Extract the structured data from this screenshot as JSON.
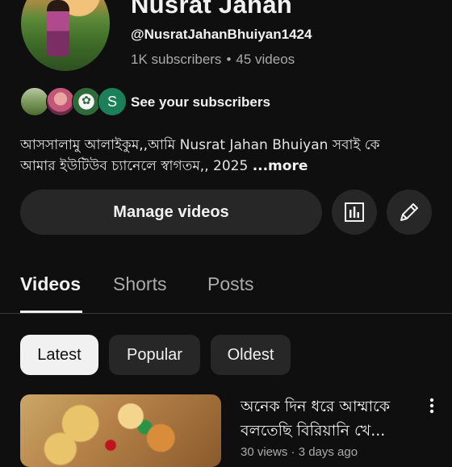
{
  "channel": {
    "name": "Nusrat Jahan",
    "handle": "@NusratJahanBhuiyan1424",
    "subscribers": "1K subscribers",
    "separator": "•",
    "videos": "45 videos"
  },
  "subscribers_row": {
    "avatars": [
      "subscriber-1",
      "subscriber-2",
      "subscriber-3",
      "subscriber-4"
    ],
    "avatar4_letter": "S",
    "label": "See your subscribers"
  },
  "description": {
    "line1": "আসসালামু আলাইকুম,,আমি Nusrat Jahan Bhuiyan সবাই কে",
    "line2": "আমার ইউটিউব চ্যানেলে স্বাগতম,, 2025 ",
    "more": "...more"
  },
  "actions": {
    "manage_videos": "Manage videos",
    "analytics_icon": "analytics-icon",
    "edit_icon": "pencil-icon"
  },
  "tabs": [
    {
      "label": "Videos",
      "active": true
    },
    {
      "label": "Shorts",
      "active": false
    },
    {
      "label": "Posts",
      "active": false
    }
  ],
  "filters": [
    {
      "label": "Latest",
      "selected": true
    },
    {
      "label": "Popular",
      "selected": false
    },
    {
      "label": "Oldest",
      "selected": false
    }
  ],
  "video": {
    "title_line1": "অনেক দিন ধরে আম্মাকে",
    "title_line2": "বলতেছি বিরিয়ানি খে...",
    "meta": "30 views · 3 days ago"
  },
  "colors": {
    "background": "#0f0f0f",
    "surface": "#272727",
    "text_primary": "#f1f1f1",
    "text_secondary": "#aaaaaa"
  }
}
